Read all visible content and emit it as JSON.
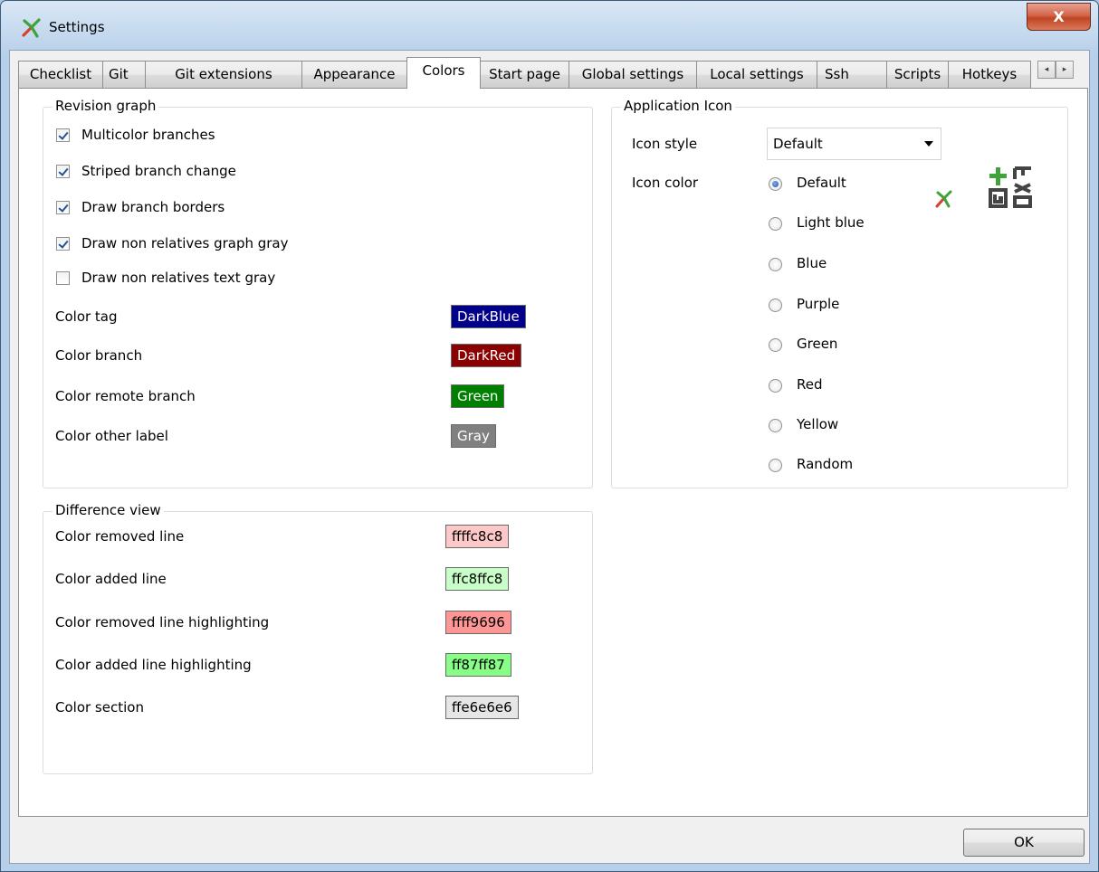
{
  "window": {
    "title": "Settings",
    "close_label": "X"
  },
  "tabs": [
    {
      "label": "Checklist"
    },
    {
      "label": "Git"
    },
    {
      "label": "Git extensions"
    },
    {
      "label": "Appearance"
    },
    {
      "label": "Colors",
      "active": true
    },
    {
      "label": "Start page"
    },
    {
      "label": "Global settings"
    },
    {
      "label": "Local settings"
    },
    {
      "label": "Ssh"
    },
    {
      "label": "Scripts"
    },
    {
      "label": "Hotkeys"
    }
  ],
  "tab_scroll": {
    "left": "◂",
    "right": "▸"
  },
  "revision_graph": {
    "title": "Revision graph",
    "checkboxes": [
      {
        "label": "Multicolor branches",
        "checked": true
      },
      {
        "label": "Striped branch change",
        "checked": true
      },
      {
        "label": "Draw branch borders",
        "checked": true
      },
      {
        "label": "Draw non relatives graph gray",
        "checked": true
      },
      {
        "label": "Draw non relatives text gray",
        "checked": false
      }
    ],
    "colors": [
      {
        "label": "Color tag",
        "value": "DarkBlue",
        "bg": "#00008b",
        "fg": "#ffffff"
      },
      {
        "label": "Color branch",
        "value": "DarkRed",
        "bg": "#8b0000",
        "fg": "#ffffff"
      },
      {
        "label": "Color remote branch",
        "value": "Green",
        "bg": "#008000",
        "fg": "#ffffff"
      },
      {
        "label": "Color other label",
        "value": "Gray",
        "bg": "#808080",
        "fg": "#ffffff"
      }
    ]
  },
  "difference_view": {
    "title": "Difference view",
    "colors": [
      {
        "label": "Color removed line",
        "value": "ffffc8c8",
        "bg": "#ffc8c8",
        "fg": "#000000"
      },
      {
        "label": "Color added line",
        "value": "ffc8ffc8",
        "bg": "#c8ffc8",
        "fg": "#000000"
      },
      {
        "label": "Color removed line highlighting",
        "value": "ffff9696",
        "bg": "#ff9696",
        "fg": "#000000"
      },
      {
        "label": "Color added line highlighting",
        "value": "ff87ff87",
        "bg": "#87ff87",
        "fg": "#000000"
      },
      {
        "label": "Color section",
        "value": "ffe6e6e6",
        "bg": "#e6e6e6",
        "fg": "#000000"
      }
    ]
  },
  "application_icon": {
    "title": "Application Icon",
    "icon_style_label": "Icon style",
    "icon_style_value": "Default",
    "icon_color_label": "Icon color",
    "colors": [
      {
        "label": "Default",
        "checked": true
      },
      {
        "label": "Light blue",
        "checked": false
      },
      {
        "label": "Blue",
        "checked": false
      },
      {
        "label": "Purple",
        "checked": false
      },
      {
        "label": "Green",
        "checked": false
      },
      {
        "label": "Red",
        "checked": false
      },
      {
        "label": "Yellow",
        "checked": false
      },
      {
        "label": "Random",
        "checked": false
      }
    ],
    "preview_small_icon": "gitext-small-icon",
    "preview_large_icon": "gitext-large-icon"
  },
  "ok_label": "OK"
}
